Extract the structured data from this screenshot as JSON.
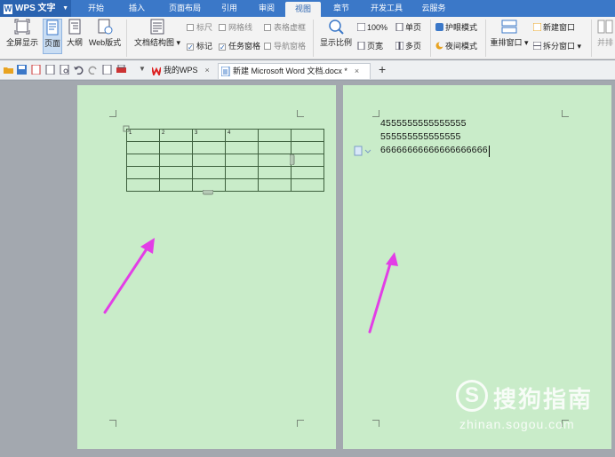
{
  "app": {
    "name": "WPS 文字",
    "logo_letter": "W"
  },
  "menu_tabs": [
    "开始",
    "插入",
    "页面布局",
    "引用",
    "审阅",
    "视图",
    "章节",
    "开发工具",
    "云服务"
  ],
  "active_tab": "视图",
  "ribbon": {
    "fullscreen": "全屏显示",
    "page": "页面",
    "outline": "大纲",
    "web_layout": "Web版式",
    "doc_structure": "文档结构图",
    "ruler": "标尺",
    "gridlines": "网格线",
    "table_gridlines": "表格虚框",
    "marks": "标记",
    "task_pane": "任务窗格",
    "nav_pane": "导航窗格",
    "zoom": "显示比例",
    "zoom_100": "100%",
    "page_width": "页宽",
    "single_page": "单页",
    "multi_page": "多页",
    "eye_mode": "护眼模式",
    "night_mode": "夜间模式",
    "arrange_windows": "重排窗口",
    "new_window": "新建窗口",
    "split_window": "拆分窗口",
    "side_by_side": "并排"
  },
  "doc_tabs": [
    {
      "label": "我的WPS",
      "close": "×"
    },
    {
      "label": "新建 Microsoft Word 文档.docx *",
      "close": "×"
    }
  ],
  "new_tab": "+",
  "table": {
    "header": [
      "1",
      "2",
      "3",
      "4",
      "",
      ""
    ],
    "rows": 5,
    "cols": 6
  },
  "document_lines": [
    "4555555555555555",
    "555555555555555",
    "66666666666666666666"
  ],
  "watermark": {
    "symbol": "S",
    "text": "搜狗指南",
    "url": "zhinan.sogou.com"
  },
  "colors": {
    "accent": "#3b78c8",
    "page_bg": "#c9ecc9",
    "arrow": "#e23ee6"
  }
}
